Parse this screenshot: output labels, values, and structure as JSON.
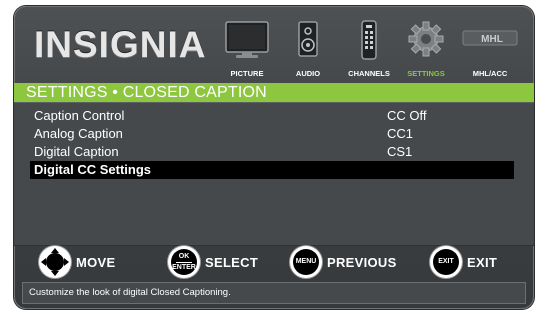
{
  "brand": "INSIGNIA",
  "tabs": [
    {
      "label": "PICTURE",
      "icon": "tv-icon"
    },
    {
      "label": "AUDIO",
      "icon": "speaker-icon"
    },
    {
      "label": "CHANNELS",
      "icon": "remote-icon"
    },
    {
      "label": "SETTINGS",
      "icon": "gear-icon",
      "active": true
    },
    {
      "label": "MHL/ACC",
      "icon": "mhl-logo-icon",
      "logo_text": "MHL"
    }
  ],
  "title": "SETTINGS • CLOSED CAPTION",
  "menu": [
    {
      "name": "Caption Control",
      "value": "CC Off"
    },
    {
      "name": "Analog Caption",
      "value": "CC1"
    },
    {
      "name": "Digital Caption",
      "value": "CS1"
    },
    {
      "name": "Digital CC Settings",
      "value": "",
      "selected": true
    }
  ],
  "legend": [
    {
      "button": "",
      "label": "MOVE",
      "icon": "dpad-icon"
    },
    {
      "button": "OK",
      "button_sub": "ENTER",
      "label": "SELECT",
      "icon": "ok-enter-button-icon"
    },
    {
      "button": "MENU",
      "label": "PREVIOUS",
      "icon": "menu-button-icon"
    },
    {
      "button": "EXIT",
      "label": "EXIT",
      "icon": "exit-button-icon"
    }
  ],
  "hint": "Customize the look of digital Closed Captioning.",
  "colors": {
    "accent": "#8dc63f",
    "panel": "#45494b",
    "selection": "#000000"
  }
}
